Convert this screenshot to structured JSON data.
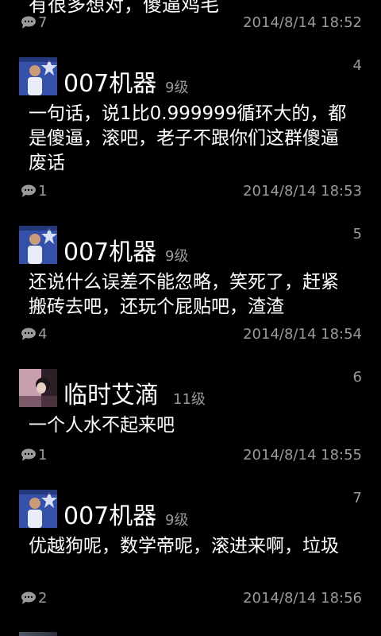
{
  "top_post": {
    "partial_text": "有很多想对，傻逼鸡毛",
    "reply_count": "7",
    "timestamp": "2014/8/14 18:52"
  },
  "posts": [
    {
      "floor": "4",
      "author": "007机器",
      "level": "9级",
      "content": "一句话，说1比0.999999循环大的，都是傻逼，滚吧，老子不跟你们这群傻逼废话",
      "reply_count": "1",
      "timestamp": "2014/8/14 18:53"
    },
    {
      "floor": "5",
      "author": "007机器",
      "level": "9级",
      "content": "还说什么误差不能忽略，笑死了，赶紧搬砖去吧，还玩个屁贴吧，渣渣",
      "reply_count": "4",
      "timestamp": "2014/8/14 18:54"
    },
    {
      "floor": "6",
      "author": "临时艾滴",
      "level": "11级",
      "content": "一个人水不起来吧",
      "reply_count": "1",
      "timestamp": "2014/8/14 18:55"
    },
    {
      "floor": "7",
      "author": "007机器",
      "level": "9级",
      "content": "优越狗呢，数学帝呢，滚进来啊，垃圾",
      "reply_count": "2",
      "timestamp": "2014/8/14 18:56"
    }
  ]
}
